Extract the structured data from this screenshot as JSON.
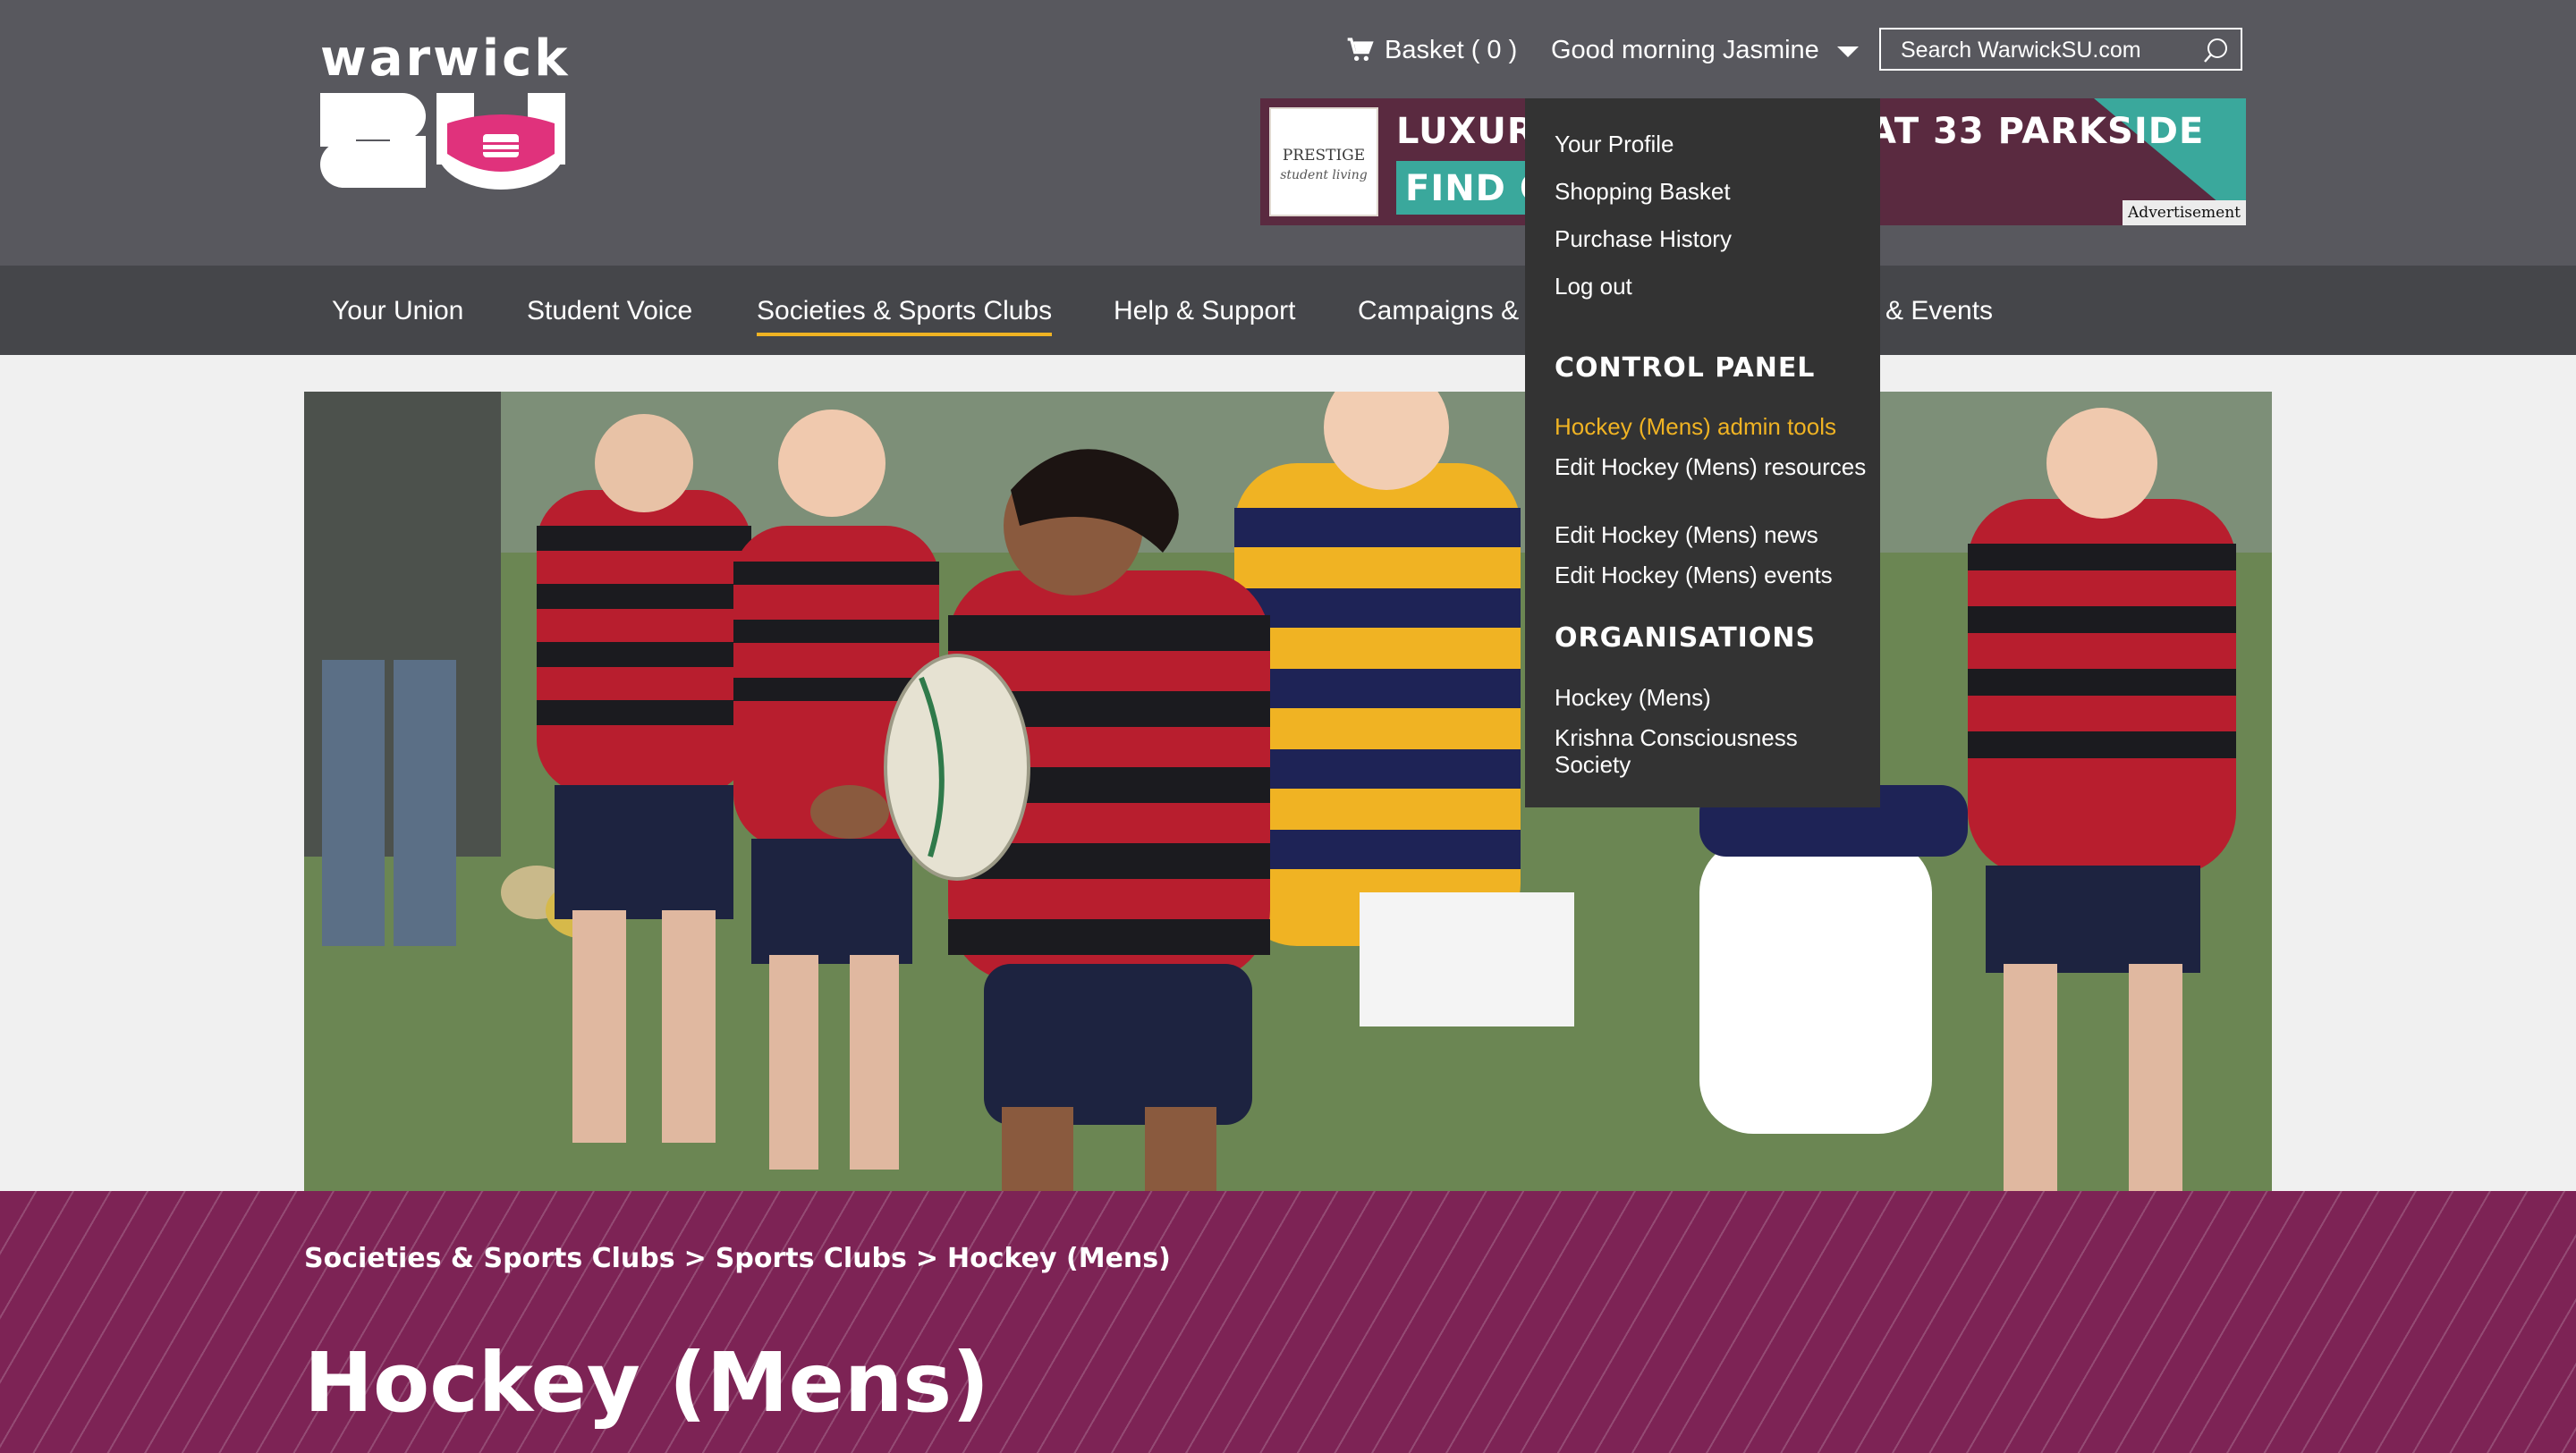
{
  "header": {
    "logo_text": "warwick",
    "logo_mark": "SU",
    "basket_label": "Basket ( 0 )",
    "basket_icon": "cart-icon",
    "greeting": "Good morning Jasmine",
    "search_placeholder": "Search WarwickSU.com",
    "search_icon": "search-icon"
  },
  "advert": {
    "logo_line1": "PRESTIGE",
    "logo_line2": "student living",
    "line1_left": "LUXURY",
    "line1_right": "AT 33 PARKSIDE",
    "line2": "FIND OU",
    "label": "Advertisement"
  },
  "nav": {
    "items": [
      {
        "label": "Your Union"
      },
      {
        "label": "Student Voice"
      },
      {
        "label": "Societies & Sports Clubs"
      },
      {
        "label": "Help & Support"
      },
      {
        "label": "Campaigns & C"
      },
      {
        "label": "& Events"
      }
    ],
    "active_index": 2
  },
  "user_menu": {
    "items": [
      "Your Profile",
      "Shopping Basket",
      "Purchase History",
      "Log out"
    ],
    "control_panel_title": "CONTROL PANEL",
    "control_panel_items": [
      "Hockey (Mens) admin tools",
      "Edit Hockey (Mens) resources",
      "Edit Hockey (Mens) news",
      "Edit Hockey (Mens) events"
    ],
    "organisations_title": "ORGANISATIONS",
    "organisations": [
      "Hockey (Mens)",
      "Krishna Consciousness Society"
    ]
  },
  "breadcrumb": [
    "Societies & Sports Clubs",
    "Sports Clubs",
    "Hockey (Mens)"
  ],
  "breadcrumb_separator": ">",
  "page_title": "Hockey (Mens)",
  "colors": {
    "header_bg": "#58585e",
    "nav_bg": "#45464a",
    "accent": "#f0b323",
    "banner_bg": "#7d2355",
    "logo_pink": "#e0327c"
  }
}
